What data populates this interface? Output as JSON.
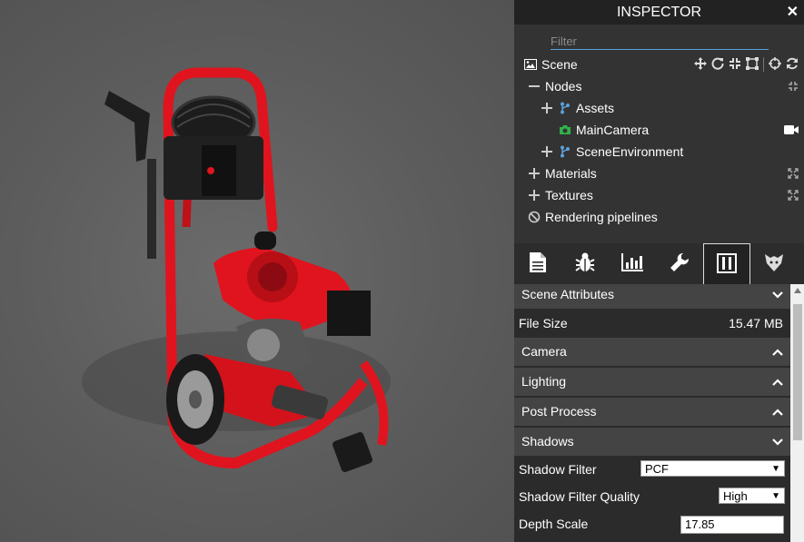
{
  "inspector": {
    "title": "INSPECTOR",
    "close_label": "✕",
    "filter_placeholder": "Filter"
  },
  "tree": {
    "scene": "Scene",
    "nodes": "Nodes",
    "assets": "Assets",
    "main_camera": "MainCamera",
    "scene_environment": "SceneEnvironment",
    "materials": "Materials",
    "textures": "Textures",
    "rendering_pipelines": "Rendering pipelines"
  },
  "tabs": [
    {
      "name": "properties",
      "icon": "file-icon"
    },
    {
      "name": "debug",
      "icon": "bug-icon"
    },
    {
      "name": "statistics",
      "icon": "chart-icon"
    },
    {
      "name": "tools",
      "icon": "wrench-icon"
    },
    {
      "name": "settings",
      "icon": "columns-icon",
      "active": true
    },
    {
      "name": "gltf",
      "icon": "glTF-icon"
    }
  ],
  "panel": {
    "scene_attributes": "Scene Attributes",
    "file_size_label": "File Size",
    "file_size_value": "15.47 MB",
    "camera": "Camera",
    "lighting": "Lighting",
    "post_process": "Post Process",
    "shadows": "Shadows",
    "shadow_filter_label": "Shadow Filter",
    "shadow_filter_value": "PCF",
    "shadow_filter_quality_label": "Shadow Filter Quality",
    "shadow_filter_quality_value": "High",
    "depth_scale_label": "Depth Scale",
    "depth_scale_value": "17.85"
  },
  "colors": {
    "accent": "#5aa0d8",
    "washer_red": "#e0141e",
    "camera_green": "#2fb24a",
    "panel_bg": "#333333",
    "header_bg": "#222222"
  }
}
